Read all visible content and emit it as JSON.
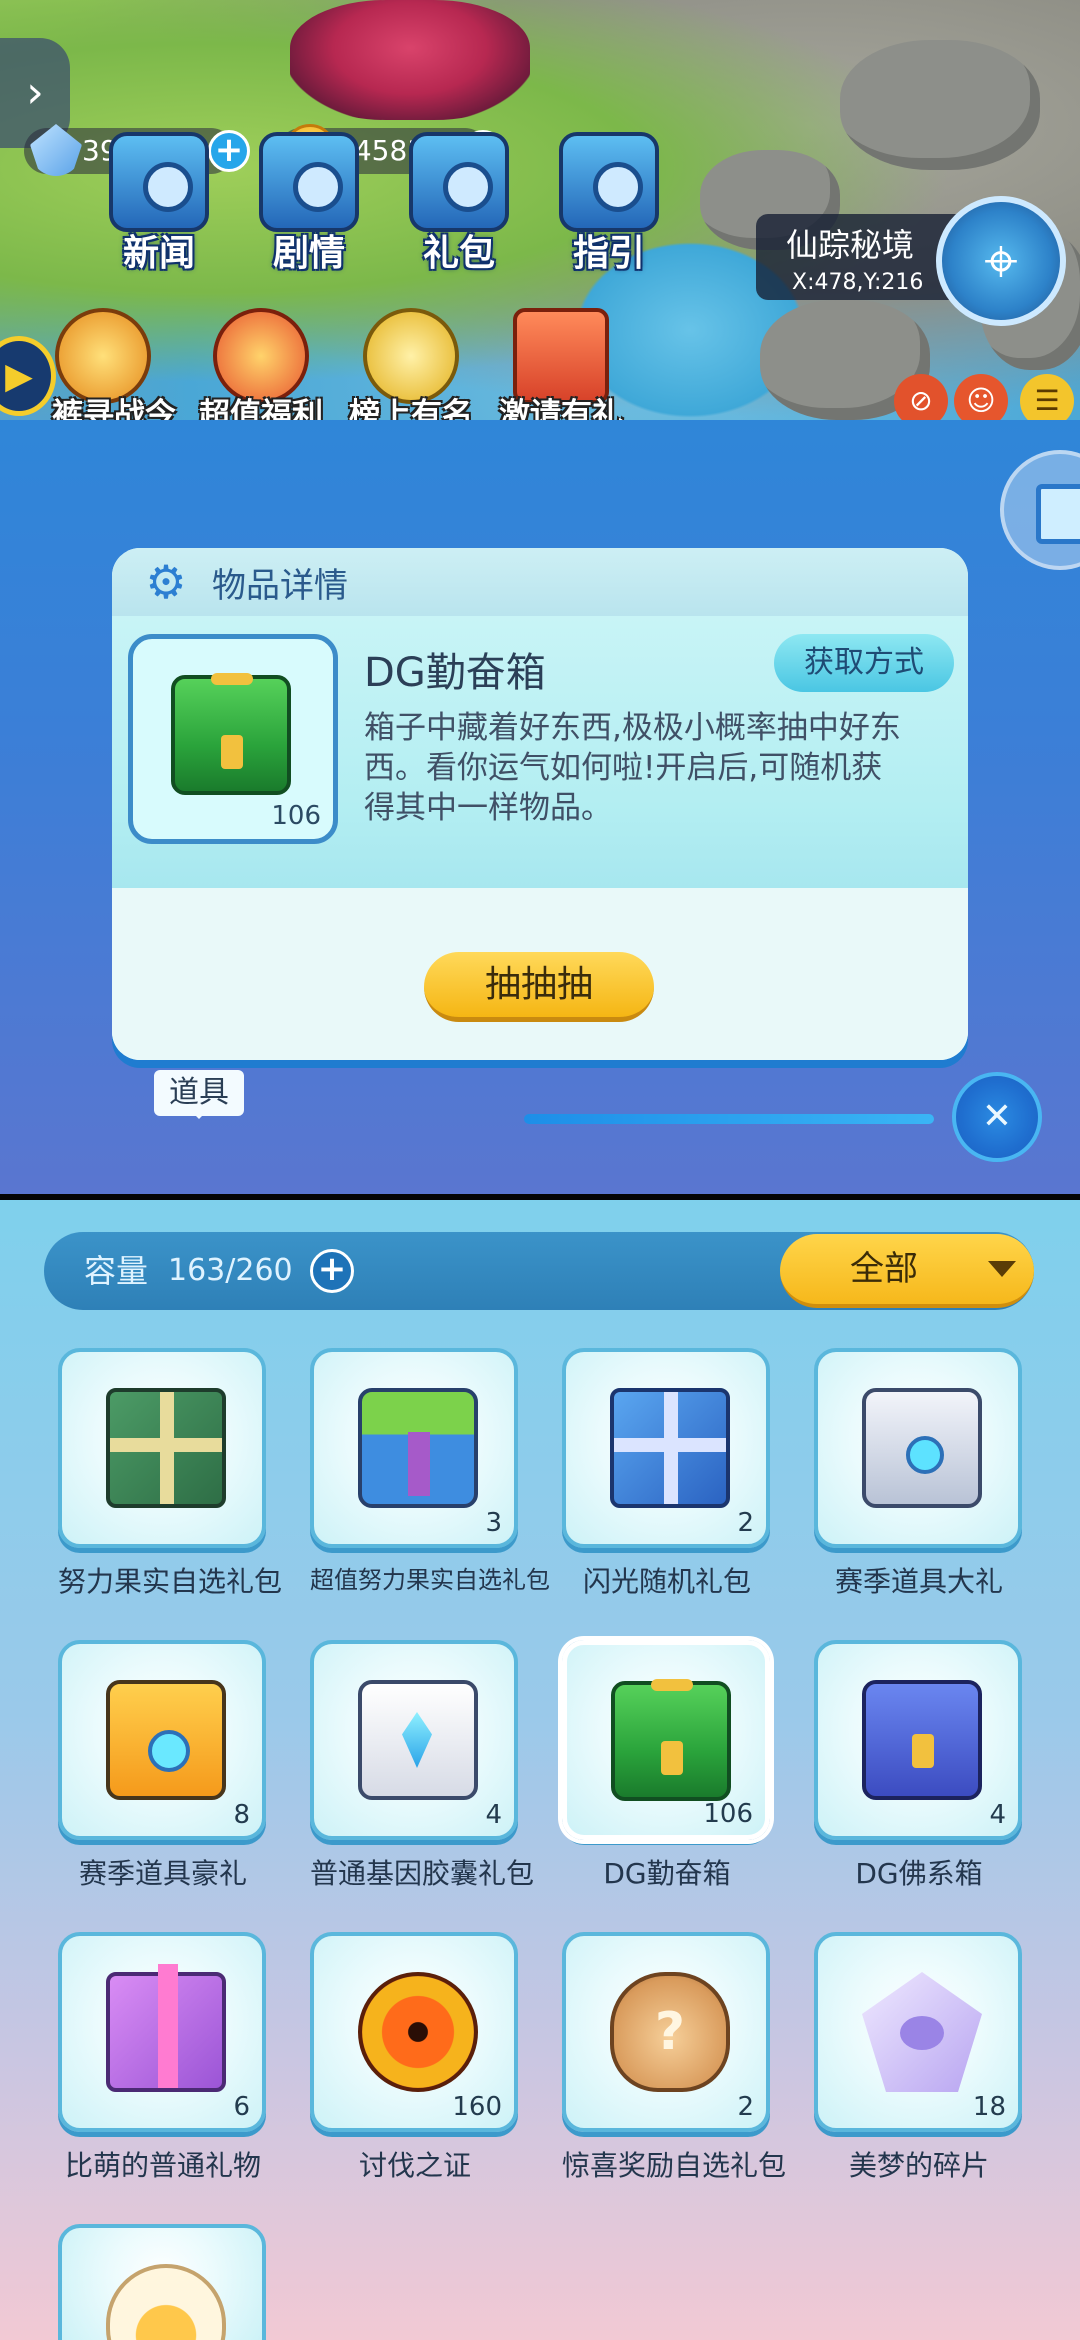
{
  "top": {
    "resources": [
      {
        "icon": "crystal-icon",
        "value": "398"
      },
      {
        "icon": "cat-coin-icon",
        "value": "645831"
      }
    ],
    "menu": [
      {
        "label": "新闻",
        "icon": "news-icon"
      },
      {
        "label": "剧情",
        "icon": "story-icon"
      },
      {
        "label": "礼包",
        "icon": "gift-pack-icon"
      },
      {
        "label": "指引",
        "icon": "guide-icon"
      }
    ],
    "map": {
      "title": "仙踪秘境",
      "coords": "X:478,Y:216"
    },
    "events": [
      {
        "label": "超值福利"
      },
      {
        "label": "榜上有名"
      },
      {
        "label": "激请有礼"
      }
    ],
    "event_partial_left": "裤寻战今"
  },
  "dialog": {
    "title": "物品详情",
    "item_name": "DG勤奋箱",
    "item_count": "106",
    "get_method_label": "获取方式",
    "description": "箱子中藏着好东西,极极小概率抽中好东西。看你运气如何啦!开启后,可随机获得其中一样物品。",
    "action_label": "抽抽抽"
  },
  "tooltip": {
    "label": "道具"
  },
  "bag": {
    "capacity_label": "容量",
    "capacity_value": "163/260",
    "filter_label": "全部",
    "items": [
      {
        "name": "努力果实自选礼包",
        "count": "",
        "art": "gift-green"
      },
      {
        "name": "超值努力果实自选礼包",
        "count": "3",
        "art": "crate-fruit"
      },
      {
        "name": "闪光随机礼包",
        "count": "2",
        "art": "gift-blue"
      },
      {
        "name": "赛季道具大礼",
        "count": "",
        "art": "crate-silver"
      },
      {
        "name": "赛季道具豪礼",
        "count": "8",
        "art": "crate-orange"
      },
      {
        "name": "普通基因胶囊礼包",
        "count": "4",
        "art": "capsule"
      },
      {
        "name": "DG勤奋箱",
        "count": "106",
        "art": "box-green"
      },
      {
        "name": "DG佛系箱",
        "count": "4",
        "art": "box-blue"
      },
      {
        "name": "比萌的普通礼物",
        "count": "6",
        "art": "gift-pink"
      },
      {
        "name": "讨伐之证",
        "count": "160",
        "art": "eye-orb"
      },
      {
        "name": "惊喜奖励自选礼包",
        "count": "2",
        "art": "sack"
      },
      {
        "name": "美梦的碎片",
        "count": "18",
        "art": "crystal"
      },
      {
        "name": "",
        "count": "",
        "art": "egg"
      }
    ]
  }
}
